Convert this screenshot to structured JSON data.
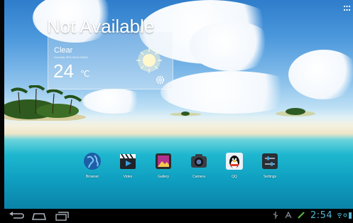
{
  "weather_widget": {
    "title": "Not Available",
    "condition": "Clear",
    "details": "Humidity 58% Wind NW(E)",
    "temperature": "24",
    "unit": "℃"
  },
  "dock": {
    "apps": [
      {
        "label": "Browser",
        "icon": "globe-icon"
      },
      {
        "label": "Video",
        "icon": "clapperboard-icon"
      },
      {
        "label": "Gallery",
        "icon": "gallery-icon"
      },
      {
        "label": "Camera",
        "icon": "camera-icon"
      },
      {
        "label": "QQ",
        "icon": "penguin-icon"
      },
      {
        "label": "Settings",
        "icon": "sliders-icon"
      }
    ]
  },
  "status_bar": {
    "clock": "2:54",
    "nav": [
      "back-icon",
      "home-icon",
      "recent-apps-icon"
    ]
  },
  "colors": {
    "clock": "#4fb7d6",
    "status_bar": "#000000"
  }
}
